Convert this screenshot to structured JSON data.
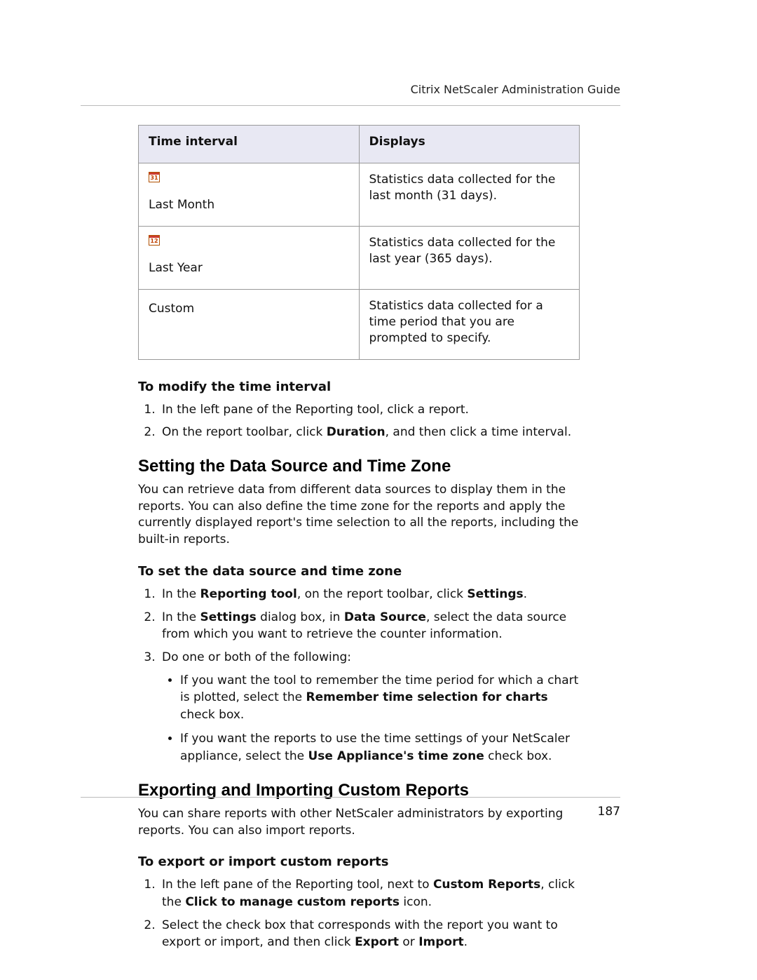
{
  "running_head": "Citrix NetScaler Administration Guide",
  "page_number": "187",
  "table": {
    "headers": {
      "c0": "Time interval",
      "c1": "Displays"
    },
    "rows": [
      {
        "icon_label": "31",
        "label": "Last Month",
        "desc": "Statistics data collected for the last month (31 days)."
      },
      {
        "icon_label": "12",
        "label": "Last Year",
        "desc": "Statistics data collected for the last year (365 days)."
      },
      {
        "icon_label": "",
        "label": "Custom",
        "desc": "Statistics data collected for a time period that you are prompted to specify."
      }
    ]
  },
  "sub1_title": "To modify the time interval",
  "sub1_steps": {
    "s1": "In the left pane of the Reporting tool, click a report.",
    "s2_a": "On the report toolbar, click ",
    "s2_b": "Duration",
    "s2_c": ", and then click a time interval."
  },
  "h2a": "Setting the Data Source and Time Zone",
  "p_a": "You can retrieve data from different data sources to display them in the reports. You can also define the time zone for the reports and apply the currently displayed report's time selection to all the reports, including the built-in reports.",
  "sub2_title": "To set the data source and time zone",
  "sub2": {
    "s1_a": "In the ",
    "s1_b": "Reporting tool",
    "s1_c": ", on the report toolbar, click ",
    "s1_d": "Settings",
    "s1_e": ".",
    "s2_a": "In the ",
    "s2_b": "Settings",
    "s2_c": " dialog box, in ",
    "s2_d": "Data Source",
    "s2_e": ", select the data source from which you want to retrieve the counter information.",
    "s3": "Do one or both of the following:",
    "b1_a": "If you want the tool to remember the time period for which a chart is plotted, select the ",
    "b1_b": "Remember time selection for charts",
    "b1_c": " check box.",
    "b2_a": "If you want the reports to use the time settings of your NetScaler appliance, select the ",
    "b2_b": "Use Appliance's time zone",
    "b2_c": " check box."
  },
  "h2b": "Exporting and Importing Custom Reports",
  "p_b": "You can share reports with other NetScaler administrators by exporting reports. You can also import reports.",
  "sub3_title": "To export or import custom reports",
  "sub3": {
    "s1_a": "In the left pane of the Reporting tool, next to ",
    "s1_b": "Custom Reports",
    "s1_c": ", click the ",
    "s1_d": "Click to manage custom reports",
    "s1_e": " icon.",
    "s2_a": "Select the check box that corresponds with the report you want to export or import, and then click ",
    "s2_b": "Export",
    "s2_c": " or ",
    "s2_d": "Import",
    "s2_e": "."
  }
}
